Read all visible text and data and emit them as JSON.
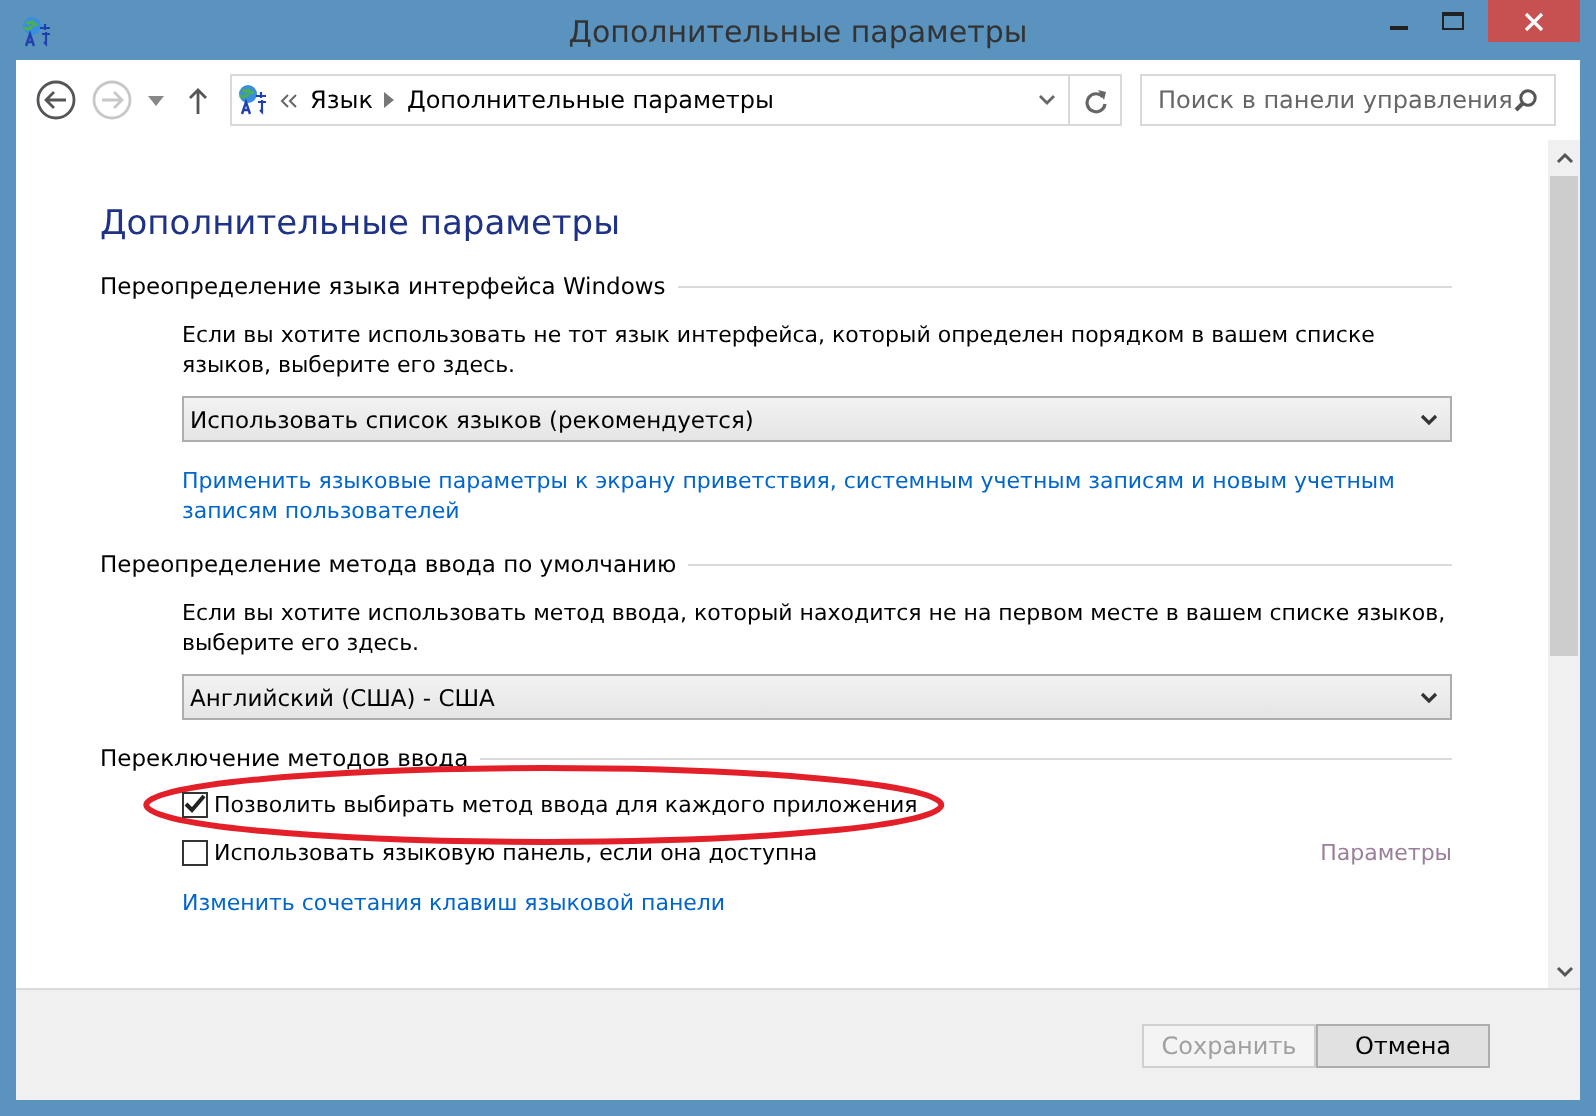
{
  "window": {
    "title": "Дополнительные параметры"
  },
  "nav": {
    "back_enabled": true,
    "forward_enabled": false
  },
  "breadcrumb": [
    "Язык",
    "Дополнительные параметры"
  ],
  "search": {
    "placeholder": "Поиск в панели управления"
  },
  "heading": "Дополнительные параметры",
  "sections": [
    {
      "title": "Переопределение языка интерфейса Windows",
      "items": [
        {
          "kind": "text",
          "text": "Если вы хотите использовать не тот язык интерфейса, который определен порядком в вашем списке языков, выберите его здесь."
        },
        {
          "kind": "dropdown",
          "value": "Использовать список языков (рекомендуется)"
        },
        {
          "kind": "link",
          "text": "Применить языковые параметры к экрану приветствия, системным учетным записям и новым учетным записям пользователей"
        }
      ]
    },
    {
      "title": "Переопределение метода ввода по умолчанию",
      "items": [
        {
          "kind": "text",
          "text": "Если вы хотите использовать метод ввода, который находится не на первом месте в вашем списке языков, выберите его здесь."
        },
        {
          "kind": "dropdown",
          "value": "Английский (США) - США"
        }
      ]
    },
    {
      "title": "Переключение методов ввода",
      "items": [
        {
          "kind": "checkbox",
          "label": "Позволить выбирать метод ввода для каждого приложения",
          "checked": true,
          "highlighted": true
        },
        {
          "kind": "checkbox",
          "label": "Использовать языковую панель, если она доступна",
          "checked": false,
          "highlighted": false,
          "action": {
            "label": "Параметры",
            "disabled": true
          }
        },
        {
          "kind": "link",
          "text": "Изменить сочетания клавиш языковой панели"
        }
      ]
    }
  ],
  "buttons": [
    {
      "label": "Сохранить",
      "disabled": true
    },
    {
      "label": "Отмена",
      "disabled": false
    }
  ]
}
